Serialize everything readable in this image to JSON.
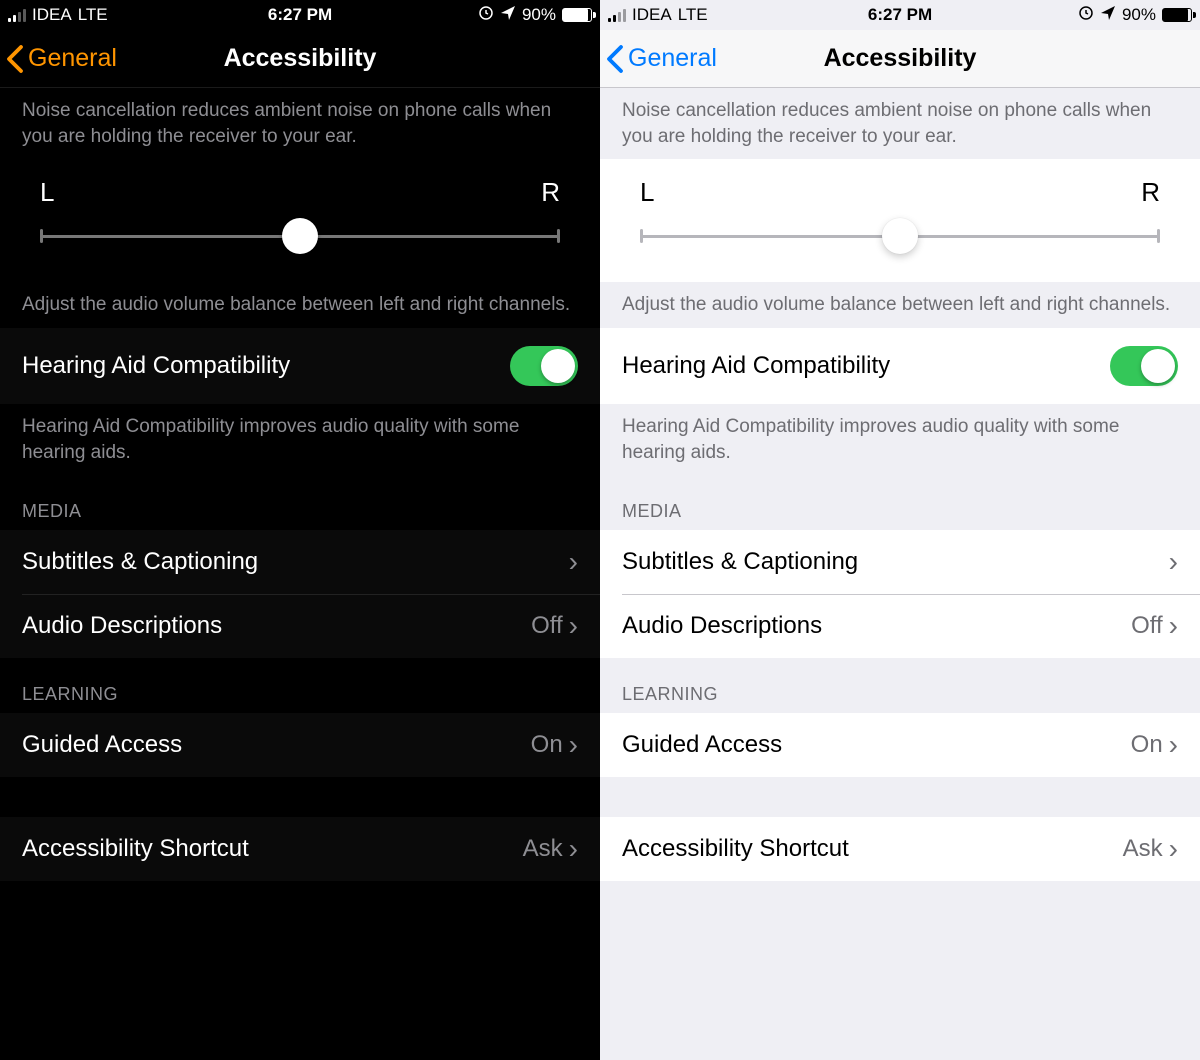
{
  "status": {
    "carrier": "IDEA",
    "network": "LTE",
    "time": "6:27 PM",
    "battery_pct": "90%",
    "lock_icon": "⊕",
    "location_icon": "➤"
  },
  "nav": {
    "back_label": "General",
    "title": "Accessibility"
  },
  "descriptions": {
    "noise_cancel": "Noise cancellation reduces ambient noise on phone calls when you are holding the receiver to your ear.",
    "balance": "Adjust the audio volume balance between left and right channels.",
    "hearing_aid": "Hearing Aid Compatibility improves audio quality with some hearing aids."
  },
  "slider": {
    "left": "L",
    "right": "R"
  },
  "rows": {
    "hearing_label": "Hearing Aid Compatibility",
    "subtitles": "Subtitles & Captioning",
    "audio_desc": "Audio Descriptions",
    "audio_desc_val": "Off",
    "guided": "Guided Access",
    "guided_val": "On",
    "shortcut": "Accessibility Shortcut",
    "shortcut_val": "Ask"
  },
  "sections": {
    "media": "MEDIA",
    "learning": "LEARNING"
  }
}
